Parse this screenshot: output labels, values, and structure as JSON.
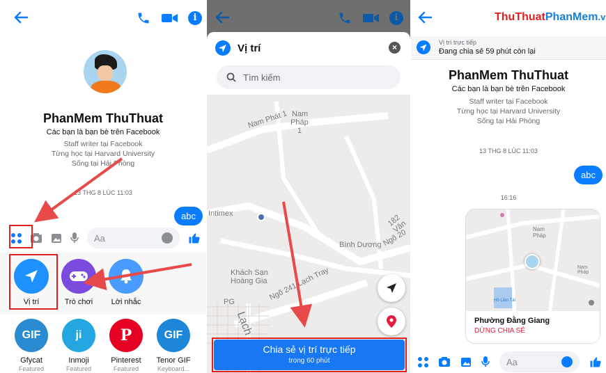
{
  "p1": {
    "profile_name": "PhanMem ThuThuat",
    "friends_line": "Các bạn là bạn bè trên Facebook",
    "info1": "Staff writer tại Facebook",
    "info2": "Từng học tại Harvard University",
    "info3": "Sống tại Hải Phòng",
    "timestamp": "13 THG 8 LÚC 11:03",
    "bubble": "abc",
    "input_placeholder": "Aa",
    "actions": [
      {
        "label": "Vị trí",
        "icon": "location-arrow-icon",
        "color": "#1e90ff"
      },
      {
        "label": "Trò chơi",
        "icon": "gamepad-icon",
        "color": "#7b4bde"
      },
      {
        "label": "Lời nhắc",
        "icon": "bell-icon",
        "color": "#4a9bff"
      }
    ],
    "apps": [
      {
        "label": "Gfycat",
        "sub": "Featured",
        "badge": "GIF",
        "color": "#2a8bd0"
      },
      {
        "label": "Inmoji",
        "sub": "Featured",
        "badge": "ji",
        "color": "#24a6e0"
      },
      {
        "label": "Pinterest",
        "sub": "Featured",
        "badge": "P",
        "color": "#e60023"
      },
      {
        "label": "Tenor GIF",
        "sub": "Keyboard...",
        "badge": "GIF",
        "color": "#1c86d8"
      }
    ]
  },
  "p2": {
    "sheet_title": "Vị trí",
    "search_placeholder": "Tìm kiếm",
    "map_labels": [
      "Nam Phát 1",
      "Nam",
      "Pháp",
      "1",
      "Intimex",
      "Bình Dương",
      "Khách Sạn",
      "Hoàng Gia",
      "Ngõ 241 Lạch Tray",
      "182 Văn",
      "Ngõ 20",
      "PG",
      "Lạch"
    ],
    "share_button": "Chia sẻ vị trí trực tiếp",
    "share_sub": "trong 60 phút"
  },
  "p3": {
    "watermark_a": "ThuThuat",
    "watermark_b": "PhanMem",
    "watermark_c": ".vn",
    "banner_small": "Vị trí trực tiếp",
    "banner_main": "Đang chia sẻ 59 phút còn lại",
    "profile_name": "PhanMem ThuThuat",
    "friends_line": "Các bạn là bạn bè trên Facebook",
    "info1": "Staff writer tại Facebook",
    "info2": "Từng học tại Harvard University",
    "info3": "Sống tại Hải Phòng",
    "timestamp": "13 THG 8 LÚC 11:03",
    "bubble": "abc",
    "time2": "16:16",
    "location_name": "Phường Đằng Giang",
    "stop_sharing": "DỪNG CHIA SẺ",
    "input_placeholder": "Aa",
    "mini_map_labels": [
      "Nam",
      "Pháp",
      "Hồ Lâm Tài",
      "Nam Pháp"
    ]
  },
  "colors": {
    "messenger_blue": "#0a7cff",
    "annotation_red": "#e02020",
    "stop_red": "#e41e3f"
  }
}
